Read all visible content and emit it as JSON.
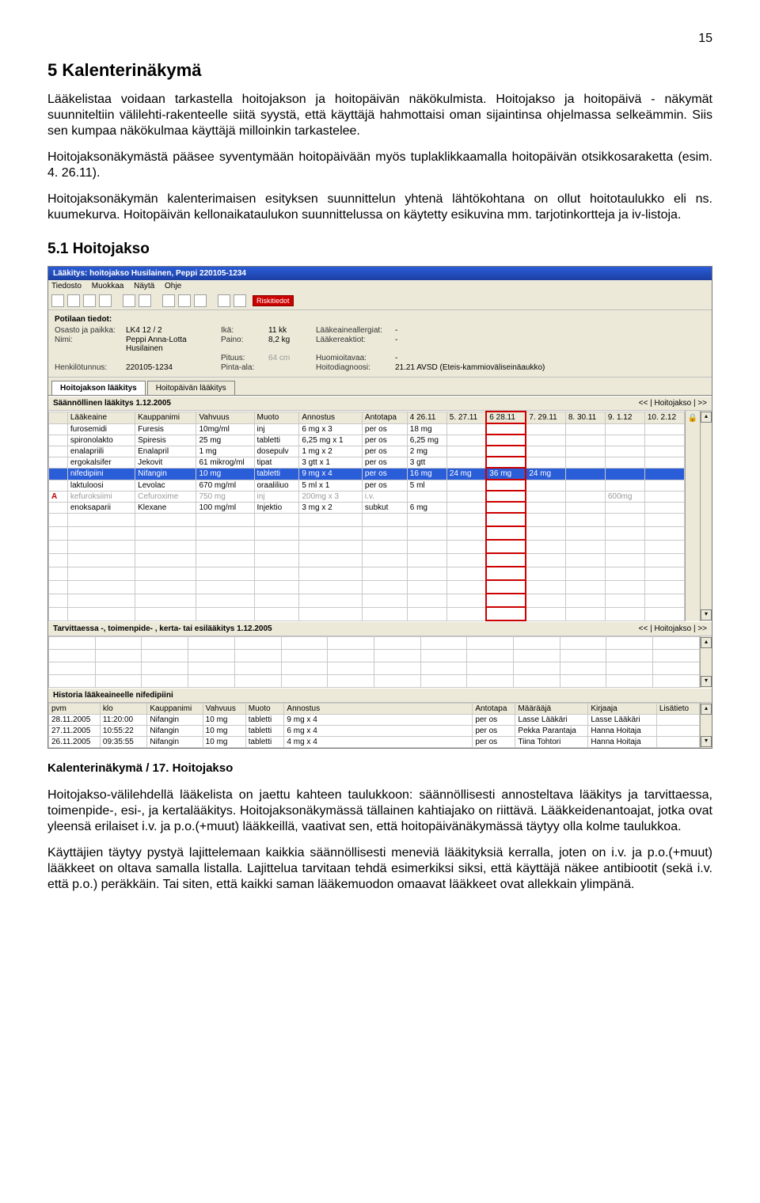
{
  "page_number": "15",
  "heading1": "5  Kalenterinäkymä",
  "para1": "Lääkelistaa voidaan tarkastella hoitojakson ja hoitopäivän näkökulmista. Hoitojakso ja hoitopäivä - näkymät suunniteltiin välilehti-rakenteelle siitä syystä, että käyttäjä hahmottaisi oman sijaintinsa ohjelmassa selkeämmin. Siis sen kumpaa näkökulmaa käyttäjä milloinkin tarkastelee.",
  "para2": "Hoitojaksonäkymästä pääsee syventymään hoitopäivään myös tuplaklikkaamalla hoitopäivän otsikkosaraketta (esim. 4. 26.11).",
  "para3": "Hoitojaksonäkymän kalenterimaisen esityksen suunnittelun yhtenä lähtökohtana on ollut hoitotaulukko eli ns. kuumekurva. Hoitopäivän kellonaikataulukon suunnittelussa on käytetty esikuvina mm. tarjotinkortteja ja iv-listoja.",
  "heading2": "5.1 Hoitojakso",
  "caption": "Kalenterinäkymä / 17. Hoitojakso",
  "para4": "Hoitojakso-välilehdellä lääkelista on jaettu kahteen taulukkoon: säännöllisesti annosteltava lääkitys ja tarvittaessa, toimenpide-, esi-, ja kertalääkitys. Hoitojaksonäkymässä tällainen kahtiajako on riittävä. Lääkkeidenantoajat, jotka ovat yleensä erilaiset i.v. ja p.o.(+muut) lääkkeillä, vaativat sen, että hoitopäivänäkymässä täytyy olla kolme taulukkoa.",
  "para5": "Käyttäjien täytyy pystyä lajittelemaan kaikkia säännöllisesti meneviä lääkityksiä kerralla, joten on i.v. ja p.o.(+muut) lääkkeet on oltava samalla listalla. Lajittelua tarvitaan tehdä esimerkiksi siksi, että käyttäjä näkee antibiootit (sekä i.v. että p.o.) peräkkäin. Tai siten, että kaikki saman lääkemuodon omaavat lääkkeet ovat allekkain ylimpänä.",
  "app": {
    "title": "Lääkitys: hoitojakso Husilainen, Peppi 220105-1234",
    "menu": [
      "Tiedosto",
      "Muokkaa",
      "Näytä",
      "Ohje"
    ],
    "risk": "Riskitiedot",
    "pt_label": "Potilaan tiedot:",
    "pt": {
      "osasto_l": "Osasto ja paikka:",
      "osasto": "LK4 12 / 2",
      "ika_l": "Ikä:",
      "ika": "11 kk",
      "allerg_l": "Lääkeaineallergiat:",
      "allerg": "-",
      "nimi_l": "Nimi:",
      "nimi": "Peppi Anna-Lotta Husilainen",
      "paino_l": "Paino:",
      "paino": "8,2 kg",
      "reaktio_l": "Lääkereaktiot:",
      "reaktio": "-",
      "pituus_l": "Pituus:",
      "pituus": "64 cm",
      "huom_l": "Huomioitavaa:",
      "huom": "-",
      "hetu_l": "Henkilötunnus:",
      "hetu": "220105-1234",
      "pinta_l": "Pinta-ala:",
      "pinta": "",
      "diag_l": "Hoitodiagnoosi:",
      "diag": "21.21 AVSD (Eteis-kammioväliseinäaukko)"
    },
    "tabs": {
      "t1": "Hoitojakson lääkitys",
      "t2": "Hoitopäivän lääkitys"
    },
    "sect1": "Säännöllinen lääkitys 1.12.2005",
    "nav": "<<  |  Hoitojakso  | >>",
    "cols": [
      "",
      "Lääkeaine",
      "Kauppanimi",
      "Vahvuus",
      "Muoto",
      "Annostus",
      "Antotapa",
      "4 26.11",
      "5. 27.11",
      "6 28.11",
      "7. 29.11",
      "8. 30.11",
      "9. 1.12",
      "10. 2.12"
    ],
    "rows": [
      {
        "a": "",
        "l": "furosemidi",
        "k": "Furesis",
        "v": "10mg/ml",
        "m": "inj",
        "an": "6 mg x 3",
        "at": "per os",
        "d": [
          "18 mg",
          "",
          "",
          "",
          "",
          "",
          ""
        ]
      },
      {
        "a": "",
        "l": "spironolakto",
        "k": "Spiresis",
        "v": "25 mg",
        "m": "tabletti",
        "an": "6,25 mg x 1",
        "at": "per os",
        "d": [
          "6,25 mg",
          "",
          "",
          "",
          "",
          "",
          ""
        ]
      },
      {
        "a": "",
        "l": "enalapriili",
        "k": "Enalapril",
        "v": "1 mg",
        "m": "dosepulv",
        "an": "1 mg x 2",
        "at": "per os",
        "d": [
          "2 mg",
          "",
          "",
          "",
          "",
          "",
          ""
        ]
      },
      {
        "a": "",
        "l": "ergokalsifer",
        "k": "Jekovit",
        "v": "61 mikrog/ml",
        "m": "tipat",
        "an": "3 gtt x 1",
        "at": "per os",
        "d": [
          "3 gtt",
          "",
          "",
          "",
          "",
          "",
          ""
        ]
      },
      {
        "a": "",
        "l": "nifedipiini",
        "k": "Nifangin",
        "v": "10 mg",
        "m": "tabletti",
        "an": "9 mg x 4",
        "at": "per os",
        "d": [
          "16 mg",
          "24 mg",
          "36 mg",
          "24 mg",
          "",
          "",
          ""
        ],
        "sel": true
      },
      {
        "a": "",
        "l": "laktuloosi",
        "k": "Levolac",
        "v": "670 mg/ml",
        "m": "oraaliliuo",
        "an": "5 ml x 1",
        "at": "per os",
        "d": [
          "5 ml",
          "",
          "",
          "",
          "",
          "",
          ""
        ]
      },
      {
        "a": "A",
        "l": "kefuroksiimi",
        "k": "Cefuroxime",
        "v": "750 mg",
        "m": "inj",
        "an": "200mg x 3",
        "at": "i.v.",
        "d": [
          "",
          "",
          "",
          "",
          "",
          "600mg",
          ""
        ],
        "dim": true
      },
      {
        "a": "",
        "l": "enoksaparii",
        "k": "Klexane",
        "v": "100 mg/ml",
        "m": "Injektio",
        "an": "3 mg x 2",
        "at": "subkut",
        "d": [
          "6 mg",
          "",
          "",
          "",
          "",
          "",
          ""
        ]
      }
    ],
    "sect2": "Tarvittaessa -, toimenpide- , kerta- tai esilääkitys 1.12.2005",
    "sect3": "Historia lääkeaineelle nifedipiini",
    "hcols": [
      "pvm",
      "klo",
      "Kauppanimi",
      "Vahvuus",
      "Muoto",
      "Annostus",
      "Antotapa",
      "Määrääjä",
      "Kirjaaja",
      "Lisätieto"
    ],
    "hrows": [
      {
        "p": "28.11.2005",
        "klo": "11:20:00",
        "k": "Nifangin",
        "v": "10 mg",
        "m": "tabletti",
        "an": "9 mg x 4",
        "at": "per os",
        "ma": "Lasse Lääkäri",
        "ki": "Lasse Lääkäri"
      },
      {
        "p": "27.11.2005",
        "klo": "10:55:22",
        "k": "Nifangin",
        "v": "10 mg",
        "m": "tabletti",
        "an": "6 mg x 4",
        "at": "per os",
        "ma": "Pekka Parantaja",
        "ki": "Hanna Hoitaja"
      },
      {
        "p": "26.11.2005",
        "klo": "09:35:55",
        "k": "Nifangin",
        "v": "10 mg",
        "m": "tabletti",
        "an": "4 mg x 4",
        "at": "per os",
        "ma": "Tiina Tohtori",
        "ki": "Hanna Hoitaja"
      }
    ]
  }
}
